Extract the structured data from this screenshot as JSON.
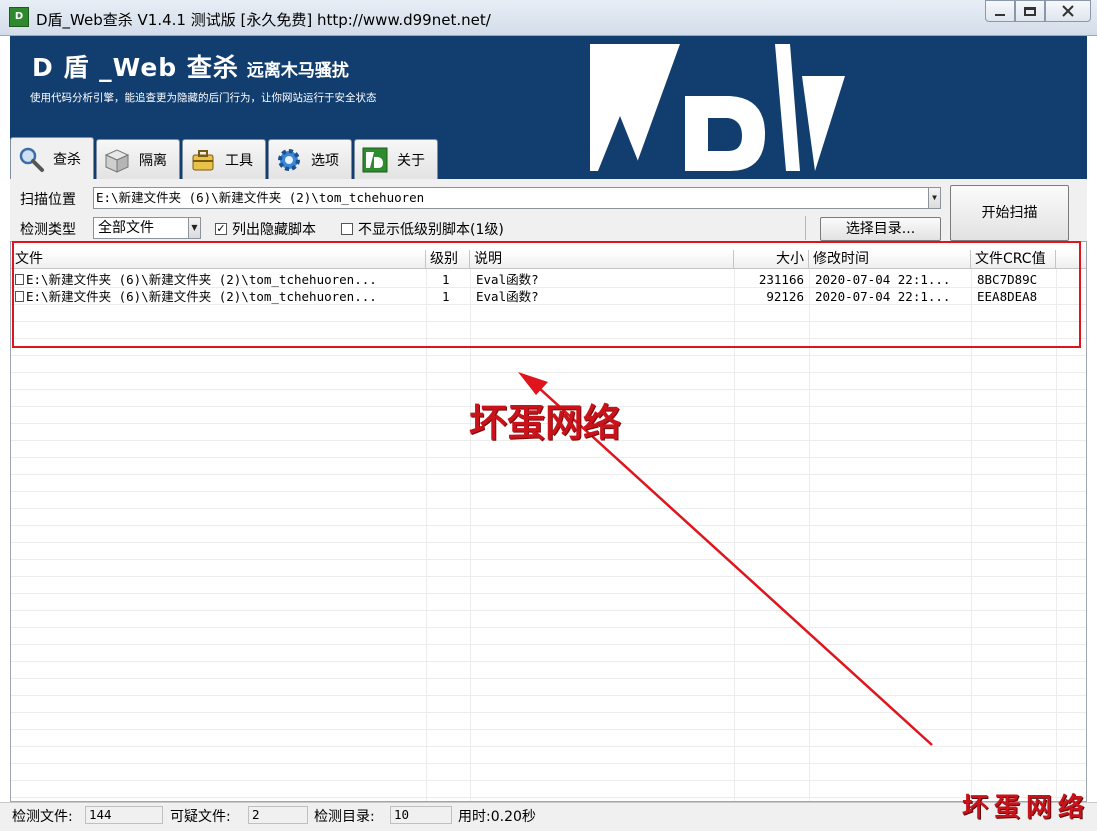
{
  "window": {
    "title": "D盾_Web查杀 V1.4.1 测试版 [永久免费] http://www.d99net.net/",
    "icon_text": "D"
  },
  "banner": {
    "brand": "D 盾 _Web 查杀",
    "brand_sub": "远离木马骚扰",
    "tagline": "使用代码分析引擎，能追查更为隐藏的后门行为，让你网站运行于安全状态",
    "bg_color": "#123e6f"
  },
  "tabs": [
    {
      "label": "查杀",
      "icon": "magnifier-icon",
      "active": true
    },
    {
      "label": "隔离",
      "icon": "box-icon",
      "active": false
    },
    {
      "label": "工具",
      "icon": "toolbox-icon",
      "active": false
    },
    {
      "label": "选项",
      "icon": "gear-icon",
      "active": false
    },
    {
      "label": "关于",
      "icon": "d-logo-icon",
      "active": false
    }
  ],
  "controls": {
    "scan_location_label": "扫描位置",
    "scan_location_value": "E:\\新建文件夹 (6)\\新建文件夹 (2)\\tom_tchehuoren",
    "detect_type_label": "检测类型",
    "detect_type_value": "全部文件",
    "list_hidden_label": "列出隐藏脚本",
    "list_hidden_checked": true,
    "hide_low_level_label": "不显示低级别脚本(1级)",
    "hide_low_level_checked": false,
    "select_dir_button": "选择目录...",
    "start_scan_button": "开始扫描"
  },
  "table": {
    "columns": [
      "文件",
      "级别",
      "说明",
      "大小",
      "修改时间",
      "文件CRC值"
    ],
    "rows": [
      {
        "file": "E:\\新建文件夹 (6)\\新建文件夹 (2)\\tom_tchehuoren...",
        "level": "1",
        "desc": "Eval函数?",
        "size": "231166",
        "mtime": "2020-07-04 22:1...",
        "crc": "8BC7D89C"
      },
      {
        "file": "E:\\新建文件夹 (6)\\新建文件夹 (2)\\tom_tchehuoren...",
        "level": "1",
        "desc": "Eval函数?",
        "size": "92126",
        "mtime": "2020-07-04 22:1...",
        "crc": "EEA8DEA8"
      }
    ]
  },
  "annotation": {
    "watermark": "坏蛋网络",
    "color": "#e0141c"
  },
  "status": {
    "checked_files_label": "检测文件:",
    "checked_files_value": "144",
    "suspicious_label": "可疑文件:",
    "suspicious_value": "2",
    "dirs_label": "检测目录:",
    "dirs_value": "10",
    "time_text": "用时:0.20秒"
  },
  "corner_watermark": "坏蛋网络"
}
